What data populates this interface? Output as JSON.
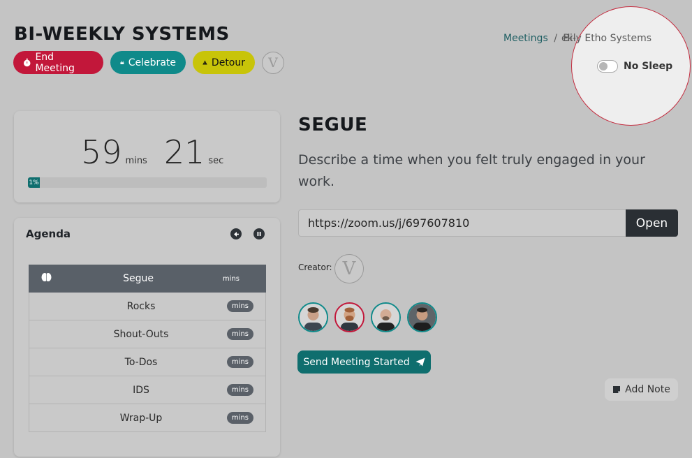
{
  "header": {
    "title": "BI-WEEKLY SYSTEMS",
    "buttons": {
      "end_meeting": "End Meeting",
      "celebrate": "Celebrate",
      "detour": "Detour"
    },
    "avatar_letter": "V"
  },
  "breadcrumb": {
    "link": "Meetings",
    "separator": "/",
    "current_partial": "Bi-",
    "current_overlay": "ekly Etho Systems"
  },
  "no_sleep": {
    "label": "No Sleep",
    "enabled": false
  },
  "timer": {
    "minutes": "59",
    "minutes_unit": "mins",
    "seconds": "21",
    "seconds_unit": "sec",
    "progress_label": "1%",
    "progress_value": 0.01
  },
  "agenda": {
    "title": "Agenda",
    "items": [
      {
        "label": "Segue",
        "badge": "mins",
        "active": true
      },
      {
        "label": "Rocks",
        "badge": "mins",
        "active": false
      },
      {
        "label": "Shout-Outs",
        "badge": "mins",
        "active": false
      },
      {
        "label": "To-Dos",
        "badge": "mins",
        "active": false
      },
      {
        "label": "IDS",
        "badge": "mins",
        "active": false
      },
      {
        "label": "Wrap-Up",
        "badge": "mins",
        "active": false
      }
    ]
  },
  "segment": {
    "title": "SEGUE",
    "prompt": "Describe a time when you felt truly engaged in your work."
  },
  "meeting_link": {
    "url": "https://zoom.us/j/697607810",
    "open_label": "Open"
  },
  "creator": {
    "label": "Creator:",
    "avatar_letter": "V"
  },
  "send_button": "Send Meeting Started",
  "add_note": "Add Note",
  "colors": {
    "accent_teal": "#0f6e6e",
    "end_meeting_red": "#c2173a",
    "detour_yellow": "#c8c409"
  }
}
